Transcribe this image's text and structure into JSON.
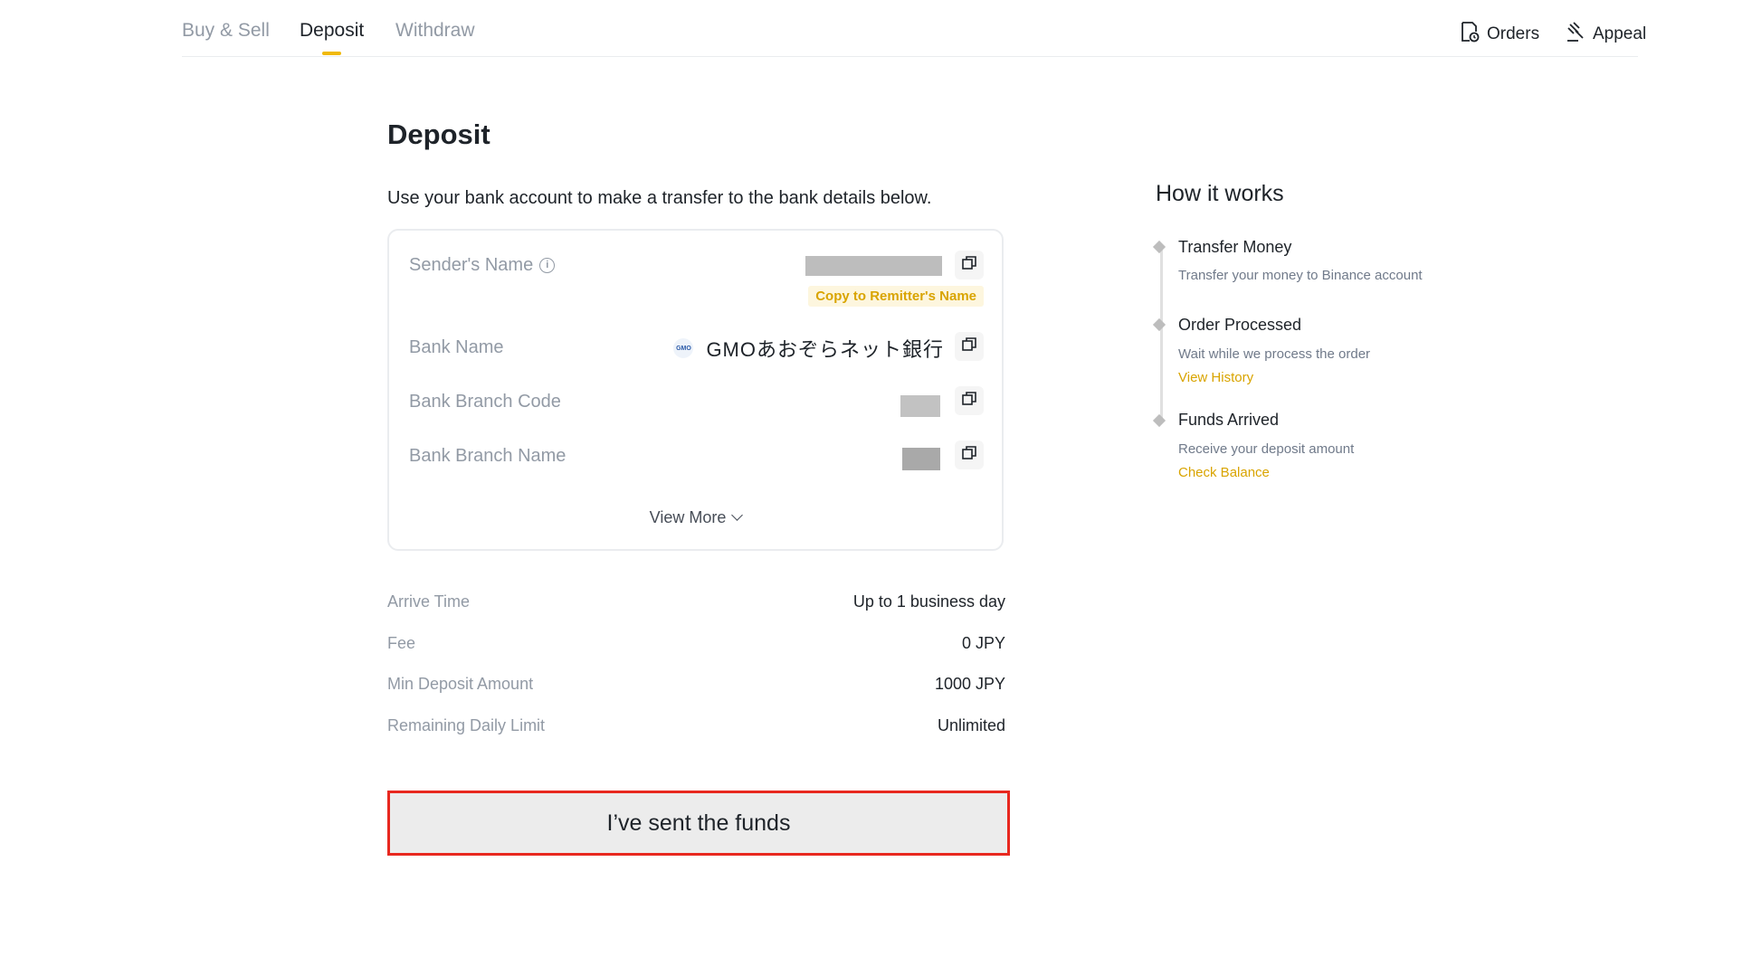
{
  "nav": {
    "tabs": [
      "Buy & Sell",
      "Deposit",
      "Withdraw"
    ],
    "orders": "Orders",
    "appeal": "Appeal"
  },
  "page": {
    "title": "Deposit",
    "subtitle": "Use your bank account to make a transfer to the bank details below."
  },
  "bank_card": {
    "sender_name_label": "Sender's Name",
    "copy_remitter": "Copy to Remitter's Name",
    "bank_name_label": "Bank Name",
    "bank_logo_text": "GMO",
    "bank_name_value": "GMOあおぞらネット銀行",
    "branch_code_label": "Bank Branch Code",
    "branch_name_label": "Bank Branch Name",
    "view_more": "View More"
  },
  "details": [
    {
      "label": "Arrive Time",
      "value": "Up to 1 business day"
    },
    {
      "label": "Fee",
      "value": "0 JPY"
    },
    {
      "label": "Min Deposit Amount",
      "value": "1000 JPY"
    },
    {
      "label": "Remaining Daily Limit",
      "value": "Unlimited"
    }
  ],
  "sent_button": "I’ve sent the funds",
  "how_it_works": {
    "title": "How it works",
    "steps": [
      {
        "title": "Transfer Money",
        "desc": "Transfer your money to Binance account",
        "link": ""
      },
      {
        "title": "Order Processed",
        "desc": "Wait while we process the order",
        "link": "View History"
      },
      {
        "title": "Funds Arrived",
        "desc": "Receive your deposit amount",
        "link": "Check Balance"
      }
    ]
  },
  "colors": {
    "accent": "#f0b90b",
    "link": "#d9a400",
    "highlight_border": "#e8281f"
  },
  "icons": [
    "orders-icon",
    "appeal-icon",
    "info-icon",
    "copy-icon",
    "chevron-down-icon",
    "gmo-bank-logo"
  ]
}
